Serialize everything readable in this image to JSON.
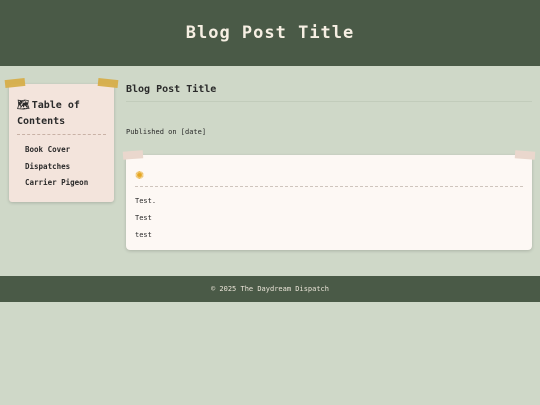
{
  "header": {
    "title": "Blog Post Title"
  },
  "toc": {
    "icon": "map-icon",
    "heading": "Table of Contents",
    "items": [
      "Book Cover",
      "Dispatches",
      "Carrier Pigeon"
    ]
  },
  "main": {
    "title": "Blog Post Title",
    "published": "Published on [date]",
    "card": {
      "icon": "sun-icon",
      "lines": [
        "Test.",
        "Test",
        "test"
      ]
    }
  },
  "footer": {
    "text": "© 2025 The Daydream Dispatch"
  },
  "colors": {
    "header_bg": "#4a5a47",
    "page_bg": "#cfd8c8",
    "toc_bg": "#f3e4dc",
    "tape": "#d6ae4a",
    "card_bg": "#fdf8f4",
    "sun": "#e6a620"
  }
}
